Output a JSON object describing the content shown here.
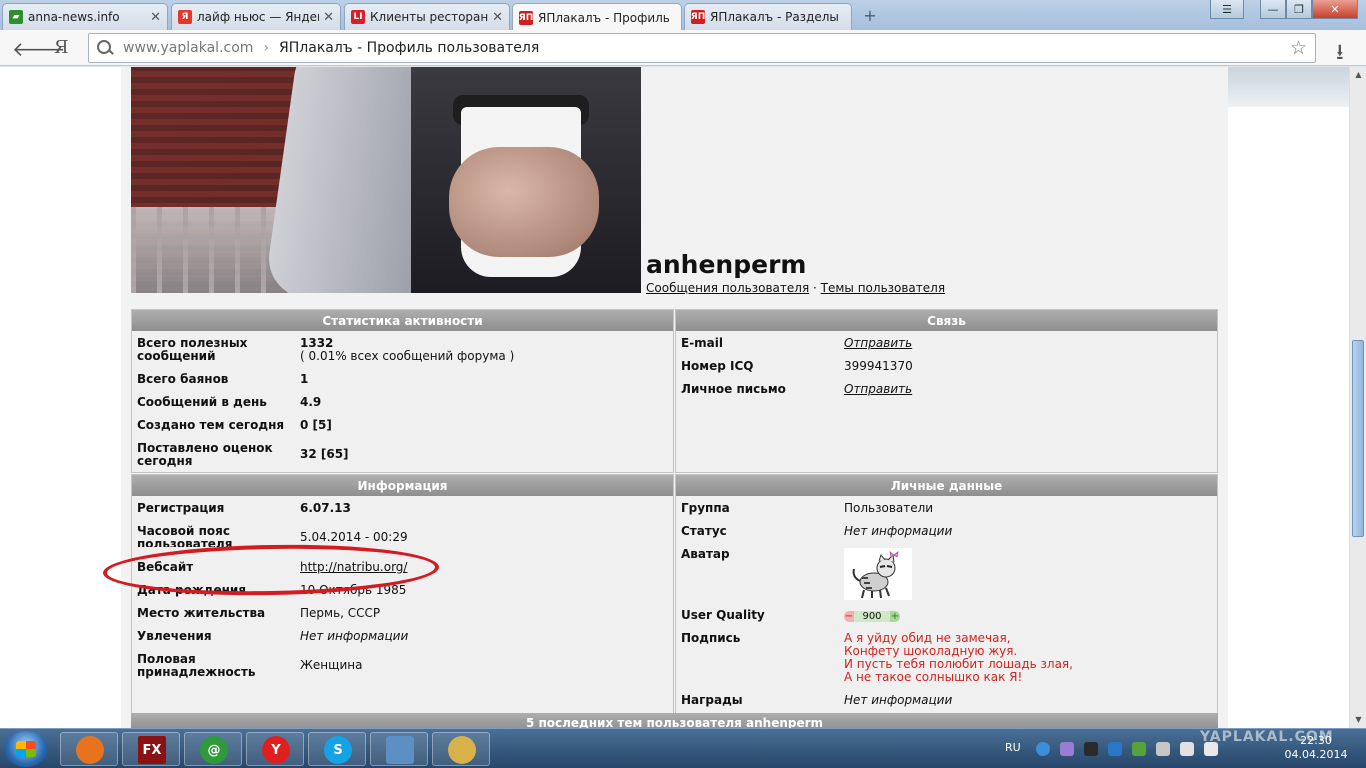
{
  "browser": {
    "tabs": [
      {
        "title": "anna-news.info",
        "fav_text": "",
        "fav_color": "#2f8f2f",
        "active": false
      },
      {
        "title": "лайф ньюс — Яндекс",
        "fav_text": "Я",
        "fav_color": "#e8362a",
        "active": false
      },
      {
        "title": "Клиенты ресторана \"",
        "fav_text": "LI",
        "fav_color": "#d8202a",
        "active": false
      },
      {
        "title": "ЯПлакалъ - Профиль",
        "fav_text": "ЯП",
        "fav_color": "#cc1f1f",
        "active": true
      },
      {
        "title": "ЯПлакалъ - Разделы",
        "fav_text": "ЯП",
        "fav_color": "#cc1f1f",
        "active": false
      }
    ],
    "new_tab": "+",
    "window_controls": {
      "minimize": "—",
      "maximize": "❐",
      "close": "✕"
    },
    "address": {
      "url": "www.yaplakal.com",
      "separator": "›",
      "page_title": "ЯПлакалъ - Профиль пользователя"
    },
    "yandex_logo": "Я"
  },
  "profile": {
    "username": "anhenperm",
    "links": {
      "messages": "Сообщения пользователя",
      "sep": "·",
      "themes": "Темы пользователя"
    }
  },
  "stats": {
    "header": "Статистика активности",
    "rows": [
      {
        "label": "Всего полезных сообщений",
        "value": "1332",
        "sub": "( 0.01% всех сообщений форума )"
      },
      {
        "label": "Всего баянов",
        "value": "1"
      },
      {
        "label": "Сообщений в день",
        "value": "4.9"
      },
      {
        "label": "Создано тем сегодня",
        "value": "0 [5]"
      },
      {
        "label": "Поставлено оценок сегодня",
        "value": "32 [65]"
      }
    ]
  },
  "contact": {
    "header": "Связь",
    "rows": [
      {
        "label": "E-mail",
        "value": "Отправить",
        "link": true
      },
      {
        "label": "Номер ICQ",
        "value": "399941370"
      },
      {
        "label": "Личное письмо",
        "value": "Отправить",
        "link": true
      }
    ]
  },
  "info": {
    "header": "Информация",
    "rows": [
      {
        "label": "Регистрация",
        "value": "6.07.13"
      },
      {
        "label": "Часовой пояс пользователя",
        "value": "5.04.2014 - 00:29"
      },
      {
        "label": "Вебсайт",
        "value": "http://natribu.org/"
      },
      {
        "label": "Дата рождения",
        "value": "10 Октябрь 1985"
      },
      {
        "label": "Место жительства",
        "value": "Пермь, СССР"
      },
      {
        "label": "Увлечения",
        "value": "Нет информации"
      },
      {
        "label": "Половая принадлежность",
        "value": "Женщина"
      }
    ]
  },
  "personal": {
    "header": "Личные данные",
    "group": {
      "label": "Группа",
      "value": "Пользователи"
    },
    "status": {
      "label": "Статус",
      "value": "Нет информации"
    },
    "avatar": {
      "label": "Аватар"
    },
    "quality": {
      "label": "User Quality",
      "minus": "−",
      "value": "900",
      "plus": "+"
    },
    "signature": {
      "label": "Подпись",
      "lines": [
        "А я уйду обид не замечая,",
        "Конфету шоколадную жуя.",
        "И пусть тебя полюбит лошадь злая,",
        "А не такое солнышко как Я!"
      ]
    },
    "awards": {
      "label": "Награды",
      "value": "Нет информации"
    }
  },
  "last_themes_header": "5 последних тем пользователя anhenperm",
  "taskbar": {
    "lang": "RU",
    "time": "22:30",
    "date": "04.04.2014",
    "apps": [
      {
        "name": "firefox",
        "text": "",
        "color": "#e8731c"
      },
      {
        "name": "fxpro",
        "text": "FX",
        "color": "#8a1212"
      },
      {
        "name": "mail-agent",
        "text": "@",
        "color": "#2e9a3a"
      },
      {
        "name": "yandex-browser",
        "text": "Y",
        "color": "#e02020"
      },
      {
        "name": "skype",
        "text": "S",
        "color": "#16a3e6"
      },
      {
        "name": "control-panel",
        "text": "",
        "color": "#5c8fc4"
      },
      {
        "name": "paint",
        "text": "",
        "color": "#d7b24a"
      }
    ]
  },
  "watermark": "YAPLAKAL.COM"
}
